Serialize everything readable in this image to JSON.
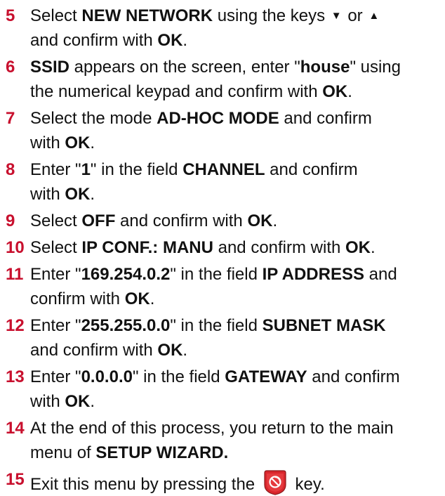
{
  "steps": [
    {
      "num": "5",
      "lines": [
        [
          "Select ",
          {
            "b": "NEW NETWORK"
          },
          " using the keys ",
          {
            "icon": "down"
          },
          " or ",
          {
            "icon": "up"
          }
        ],
        [
          "and confirm with ",
          {
            "b": "OK"
          },
          "."
        ]
      ]
    },
    {
      "num": "6",
      "lines": [
        [
          {
            "b": "SSID"
          },
          " appears on the screen, enter \"",
          {
            "b": "house"
          },
          "\" using"
        ],
        [
          "the numerical keypad and confirm with ",
          {
            "b": "OK"
          },
          "."
        ]
      ]
    },
    {
      "num": "7",
      "lines": [
        [
          "Select the mode ",
          {
            "b": "AD-HOC MODE"
          },
          " and confirm"
        ],
        [
          "with ",
          {
            "b": "OK"
          },
          "."
        ]
      ]
    },
    {
      "num": "8",
      "lines": [
        [
          "Enter \"",
          {
            "b": "1"
          },
          "\" in the field ",
          {
            "b": "CHANNEL"
          },
          " and confirm"
        ],
        [
          "with ",
          {
            "b": "OK"
          },
          "."
        ]
      ]
    },
    {
      "num": "9",
      "lines": [
        [
          "Select ",
          {
            "b": "OFF"
          },
          " and confirm with ",
          {
            "b": "OK"
          },
          "."
        ]
      ]
    },
    {
      "num": "10",
      "lines": [
        [
          "Select ",
          {
            "b": "IP CONF.: MANU"
          },
          " and confirm with ",
          {
            "b": "OK"
          },
          "."
        ]
      ]
    },
    {
      "num": "11",
      "lines": [
        [
          "Enter \"",
          {
            "b": "169.254.0.2"
          },
          "\" in the field ",
          {
            "b": "IP ADDRESS"
          },
          " and"
        ],
        [
          "confirm with ",
          {
            "b": "OK"
          },
          "."
        ]
      ]
    },
    {
      "num": "12",
      "lines": [
        [
          "Enter \"",
          {
            "b": "255.255.0.0"
          },
          "\" in the field ",
          {
            "b": "SUBNET MASK"
          }
        ],
        [
          "and confirm with ",
          {
            "b": "OK"
          },
          "."
        ]
      ]
    },
    {
      "num": "13",
      "lines": [
        [
          "Enter \"",
          {
            "b": "0.0.0.0"
          },
          "\" in the field ",
          {
            "b": "GATEWAY"
          },
          " and confirm"
        ],
        [
          "with ",
          {
            "b": "OK"
          },
          "."
        ]
      ]
    },
    {
      "num": "14",
      "lines": [
        [
          "At the end of this process, you return to the main"
        ],
        [
          "menu of ",
          {
            "b": "SETUP WIZARD."
          }
        ]
      ]
    },
    {
      "num": "15",
      "lines": [
        [
          "Exit this menu by pressing the ",
          {
            "icon": "stop-key"
          },
          " key."
        ]
      ]
    }
  ],
  "icons": {
    "down": "arrow-down-icon",
    "up": "arrow-up-icon",
    "stop-key": "stop-key-icon"
  },
  "colors": {
    "step_number": "#c8102e",
    "stop_key": "#d9262c"
  }
}
